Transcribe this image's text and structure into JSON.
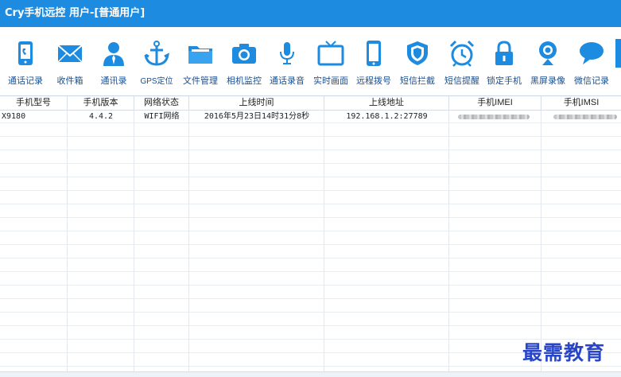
{
  "window": {
    "title": "Cry手机远控 用户-[普通用户]"
  },
  "toolbar": {
    "items": [
      {
        "label": "通话记录",
        "icon": "call-log-icon"
      },
      {
        "label": "收件箱",
        "icon": "envelope-icon"
      },
      {
        "label": "通讯录",
        "icon": "contacts-icon"
      },
      {
        "label": "GPS定位",
        "icon": "gps-icon"
      },
      {
        "label": "文件管理",
        "icon": "folder-icon"
      },
      {
        "label": "相机监控",
        "icon": "camera-icon"
      },
      {
        "label": "通话录音",
        "icon": "microphone-icon"
      },
      {
        "label": "实时画面",
        "icon": "tv-icon"
      },
      {
        "label": "远程拨号",
        "icon": "phone-icon"
      },
      {
        "label": "短信拦截",
        "icon": "shield-icon"
      },
      {
        "label": "短信提醒",
        "icon": "alarm-clock-icon"
      },
      {
        "label": "锁定手机",
        "icon": "lock-icon"
      },
      {
        "label": "黑屏录像",
        "icon": "webcam-icon"
      },
      {
        "label": "微信记录",
        "icon": "chat-bubble-icon"
      }
    ],
    "accent": "#1c8be0"
  },
  "table": {
    "columns": [
      "手机型号",
      "手机版本",
      "网络状态",
      "上线时间",
      "上线地址",
      "手机IMEI",
      "手机IMSI"
    ],
    "rows": [
      {
        "model": "X9180",
        "version": "4.4.2",
        "network": "WIFI网络",
        "online_time": "2016年5月23日14时31分8秒",
        "address": "192.168.1.2:27789"
      }
    ]
  },
  "watermark": "最需教育"
}
